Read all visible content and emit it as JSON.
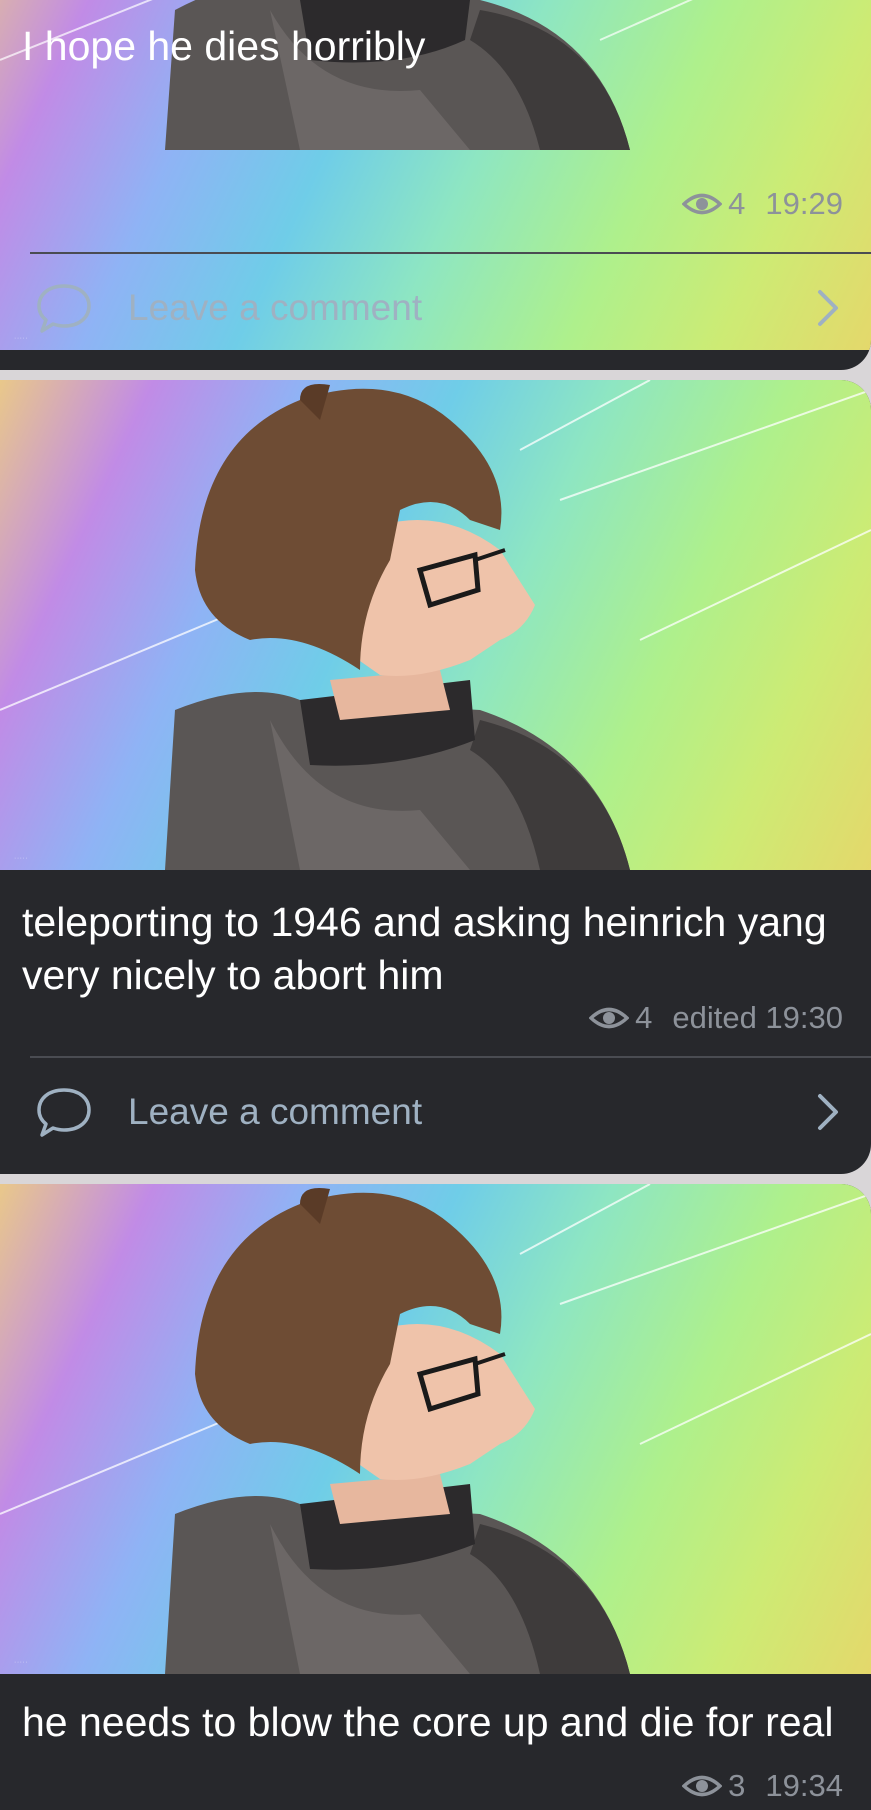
{
  "posts": [
    {
      "caption": "I hope he dies horribly",
      "views": "4",
      "time": "19:29",
      "comment_label": "Leave a comment"
    },
    {
      "caption": "teleporting to 1946 and asking heinrich yang very nicely to abort him",
      "views": "4",
      "time": "edited 19:30",
      "comment_label": "Leave a comment"
    },
    {
      "caption": "he needs to blow the core up and die for real",
      "views": "3",
      "time": "19:34"
    }
  ],
  "icons": {
    "views": "eye-icon",
    "comment": "speech-bubble-icon",
    "open": "chevron-right-icon"
  },
  "colors": {
    "card_background": "#27282c",
    "caption_text": "#ffffff",
    "meta_text": "#8d929a",
    "comment_link": "#9fb1c2"
  }
}
